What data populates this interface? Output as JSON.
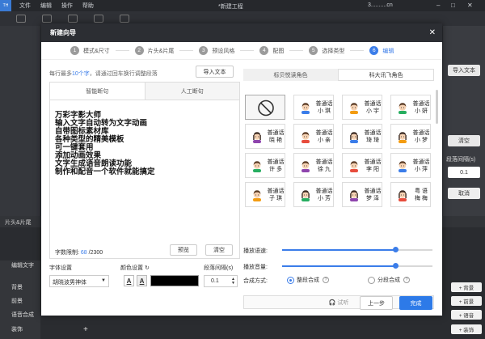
{
  "app": {
    "logo": "TH",
    "menu": [
      "文件",
      "编辑",
      "操作",
      "帮助"
    ],
    "title": "*新建工程",
    "user": "3..........cn"
  },
  "bg_right": {
    "import_text": "导入文本",
    "clear": "清空",
    "para_spacing_label": "段落间隔(s)",
    "spacing_value": "0.1",
    "cancel": "取消"
  },
  "timeline": {
    "head": "片头&片尾",
    "tracks": [
      "编辑文字",
      "背景",
      "前景",
      "语音合成",
      "装饰"
    ],
    "add_buttons": [
      "+ 背景",
      "+ 前景",
      "+ 语音",
      "+ 装饰"
    ],
    "add_plus": "+"
  },
  "dialog": {
    "title": "新建向导",
    "steps": [
      {
        "num": "1",
        "label": "模式&尺寸"
      },
      {
        "num": "2",
        "label": "片头&片尾"
      },
      {
        "num": "3",
        "label": "预设风格"
      },
      {
        "num": "4",
        "label": "配图"
      },
      {
        "num": "5",
        "label": "选择类型"
      },
      {
        "num": "6",
        "label": "编辑"
      }
    ],
    "hint_pre": "每行最多",
    "hint_num": "10个字",
    "hint_post": "，请通过回车换行调整段落",
    "import_button": "导入文本",
    "tabs": [
      "智能断句",
      "人工断句"
    ],
    "text_lines": [
      "万彩字影大师",
      "输入文字自动转为文字动画",
      "自带图标素材库",
      "各种类型的精美模板",
      "可一键套用",
      "添加动画效果",
      "文字生成语音朗读功能",
      "制作和配音一个软件就能搞定"
    ],
    "count_label": "字数限制:",
    "count_value": "68",
    "count_max": "/2300",
    "preview_button": "预览",
    "clear_button": "清空",
    "font_label": "字体设置",
    "font_value": "胡晓波男神体",
    "color_label": "颜色设置",
    "spacing_label": "段落间隔(s)",
    "spacing_value": "0.1",
    "color_value": "#000000",
    "voice_tabs": [
      "标贝悦读角色",
      "科大讯飞角色"
    ],
    "voices": [
      {
        "type": "none",
        "l1": "",
        "l2": ""
      },
      {
        "type": "m",
        "l1": "普通话",
        "l2": "小 琪"
      },
      {
        "type": "m",
        "l1": "普通话",
        "l2": "小 宇"
      },
      {
        "type": "m",
        "l1": "普通话",
        "l2": "小 妍"
      },
      {
        "type": "f",
        "l1": "普通话",
        "l2": "晓 艳"
      },
      {
        "type": "m",
        "l1": "普通话",
        "l2": "小 亲"
      },
      {
        "type": "f",
        "l1": "普通话",
        "l2": "琦 琦"
      },
      {
        "type": "f",
        "l1": "普通话",
        "l2": "小 梦"
      },
      {
        "type": "m",
        "l1": "普通话",
        "l2": "许 多"
      },
      {
        "type": "m",
        "l1": "普通话",
        "l2": "徐 九"
      },
      {
        "type": "m",
        "l1": "普通话",
        "l2": "李 阳"
      },
      {
        "type": "m",
        "l1": "普通话",
        "l2": "小 萍"
      },
      {
        "type": "m",
        "l1": "普通话",
        "l2": "子 琪"
      },
      {
        "type": "f",
        "l1": "普通话",
        "l2": "小 芳"
      },
      {
        "type": "f",
        "l1": "普通话",
        "l2": "梦 泽"
      },
      {
        "type": "f",
        "l1": "粤 语",
        "l2": "梅 梅"
      }
    ],
    "speed_label": "播放语速:",
    "volume_label": "播放音量:",
    "speed_value": 0.75,
    "volume_value": 0.75,
    "mode_label": "合成方式:",
    "mode_whole": "整段合成",
    "mode_split": "分段合成",
    "help_glyph": "?",
    "listen_label": "试听",
    "prev_button": "上一步",
    "done_button": "完成"
  },
  "colors": {
    "accent": "#3b7de9",
    "dark": "#2c2e33"
  }
}
